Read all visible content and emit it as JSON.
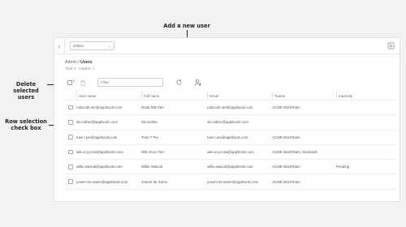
{
  "annotations": {
    "add_user": "Add a new user",
    "delete_selected_line1": "Delete selected",
    "delete_selected_line2": "users",
    "row_selection_line1": "Row selection",
    "row_selection_line2": "check box"
  },
  "topbar": {
    "org_selected": "Admin",
    "org_chevron": "⌄",
    "back_glyph": "‹"
  },
  "breadcrumb": {
    "parent": "Admin",
    "separator": "/",
    "current": "Users"
  },
  "counts_text": "Total: 6  ·  Inactive: 1",
  "toolbar": {
    "filter_placeholder": "Filter",
    "caret": "▾"
  },
  "table": {
    "headers": [
      "User name",
      "Full name",
      "Email",
      "Teams",
      "Inactivity"
    ],
    "rows": [
      {
        "username": "roda.rah.ner@applitools.com",
        "fullname": "Roda Rah Ner",
        "email": "roda.rah.ner@applitools.com",
        "teams": "ACME WorkTeam",
        "inactivity": ""
      },
      {
        "username": "slv.esther@applitools.com",
        "fullname": "Slv Esther",
        "email": "slv.esther@applitools.com",
        "teams": "",
        "inactivity": ""
      },
      {
        "username": "tuse.t.pie@applitools.com",
        "fullname": "Tuse T Pie",
        "email": "tuse.t.pie@applitools.com",
        "teams": "ACME WorkTeam",
        "inactivity": ""
      },
      {
        "username": "wile.ecyo.tea@applitools.com",
        "fullname": "Wile Ecyo Tea",
        "email": "wile.ecyo.tea@applitools.com",
        "teams": "ACME WorkTeam, Sacelash",
        "inactivity": ""
      },
      {
        "username": "willie.wascal@applitools.com",
        "fullname": "Willie Wascal",
        "email": "willie.wascal@applitools.com",
        "teams": "ACME WorkTeam",
        "inactivity": "Pending"
      },
      {
        "username": "yosem.ite.same@applitools.com",
        "fullname": "Yosem Ite Same",
        "email": "yosem.ite.same@applitools.com",
        "teams": "ACME WorkTeam",
        "inactivity": ""
      }
    ]
  },
  "colors": {
    "background": "#f2f2f2",
    "panel": "#ffffff",
    "annotation": "#222222",
    "border": "#e6e6e6"
  }
}
